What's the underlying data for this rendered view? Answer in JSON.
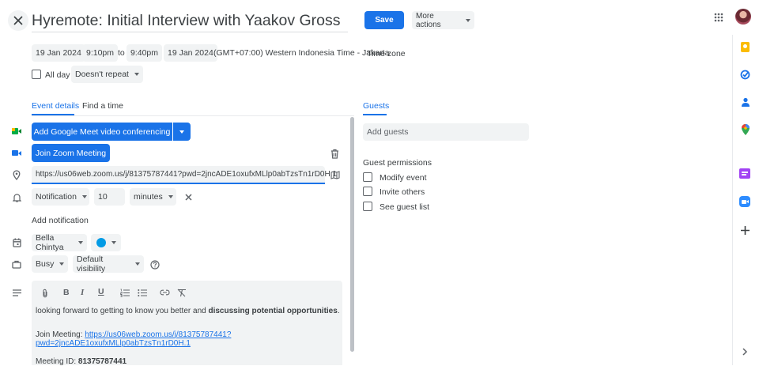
{
  "header": {
    "title": "Hyremote: Initial Interview with Yaakov Gross",
    "save_label": "Save",
    "more_actions_label": "More actions"
  },
  "datetime": {
    "start_date": "19 Jan 2024",
    "start_time": "9:10pm",
    "to_label": "to",
    "end_time": "9:40pm",
    "end_date": "19 Jan 2024",
    "timezone_text": "(GMT+07:00) Western Indonesia Time - Jakarta",
    "timezone_button": "Time zone",
    "allday_label": "All day",
    "repeat_value": "Doesn't repeat"
  },
  "tabs": {
    "event_details": "Event details",
    "find_time": "Find a time",
    "guests": "Guests"
  },
  "conferencing": {
    "meet_label": "Add Google Meet video conferencing",
    "zoom_label": "Join Zoom Meeting"
  },
  "location": {
    "value": "https://us06web.zoom.us/j/81375787441?pwd=2jncADE1oxufxMLlp0abTzsTn1rD0H.1"
  },
  "notification": {
    "type": "Notification",
    "amount": "10",
    "unit": "minutes",
    "add_label": "Add notification"
  },
  "calendar": {
    "owner": "Bella Chintya",
    "color": "#039be5"
  },
  "availability": {
    "busy": "Busy",
    "visibility": "Default visibility"
  },
  "description": {
    "line1_prefix": "looking forward to getting to know you better and ",
    "line1_bold": "discussing potential opportunities",
    "line1_suffix": ".",
    "join_prefix": "Join Meeting: ",
    "join_link_1": "https://us06web.zoom.us/j/81375787441?",
    "join_link_2": "pwd=2jncADE1oxufxMLlp0abTzsTn1rD0H.1",
    "meeting_id_label": "Meeting ID: ",
    "meeting_id": "81375787441"
  },
  "guests": {
    "placeholder": "Add guests",
    "permissions_title": "Guest permissions",
    "modify": "Modify event",
    "invite": "Invite others",
    "see_list": "See guest list"
  },
  "colors": {
    "accent": "#1a73e8",
    "keep": "#fbbc04",
    "tasks": "#1a73e8",
    "contacts": "#1a73e8",
    "zoom": "#2d8cff"
  },
  "icons": [
    "close-icon",
    "apps-grid-icon",
    "avatar",
    "keep-icon",
    "tasks-icon",
    "contacts-icon",
    "maps-icon",
    "addon-icon",
    "zoom-icon",
    "plus-icon",
    "chevron-right-icon",
    "google-meet-icon",
    "video-icon",
    "location-icon",
    "bell-icon",
    "calendar-icon",
    "briefcase-icon",
    "description-icon",
    "trash-icon",
    "map-icon",
    "help-icon",
    "attach-icon",
    "bold-icon",
    "italic-icon",
    "underline-icon",
    "numbered-list-icon",
    "bulleted-list-icon",
    "link-icon",
    "clear-format-icon"
  ]
}
